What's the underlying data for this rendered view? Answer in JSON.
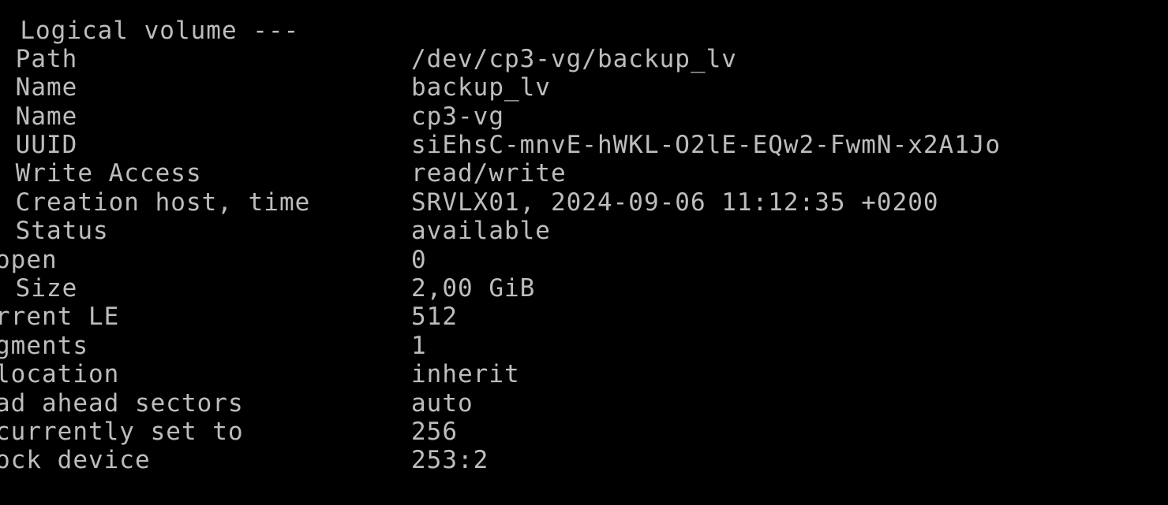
{
  "terminal": {
    "header": "- Logical volume ---",
    "rows": [
      {
        "label": " Path",
        "value": "/dev/cp3-vg/backup_lv"
      },
      {
        "label": " Name",
        "value": "backup_lv"
      },
      {
        "label": " Name",
        "value": "cp3-vg"
      },
      {
        "label": " UUID",
        "value": "siEhsC-mnvE-hWKL-O2lE-EQw2-FwmN-x2A1Jo"
      },
      {
        "label": " Write Access",
        "value": "read/write"
      },
      {
        "label": " Creation host, time",
        "value": "SRVLX01, 2024-09-06 11:12:35 +0200"
      },
      {
        "label": " Status",
        "value": "available"
      },
      {
        "label": "open",
        "value": "0"
      },
      {
        "label": " Size",
        "value": "2,00 GiB"
      },
      {
        "label": "rrent LE",
        "value": "512"
      },
      {
        "label": "gments",
        "value": "1"
      },
      {
        "label": "location",
        "value": "inherit"
      },
      {
        "label": "ad ahead sectors",
        "value": "auto"
      },
      {
        "label": "currently set to",
        "value": "256"
      },
      {
        "label": "ock device",
        "value": "253:2"
      }
    ]
  },
  "colors": {
    "background": "#000000",
    "text": "#bdbdbd"
  }
}
